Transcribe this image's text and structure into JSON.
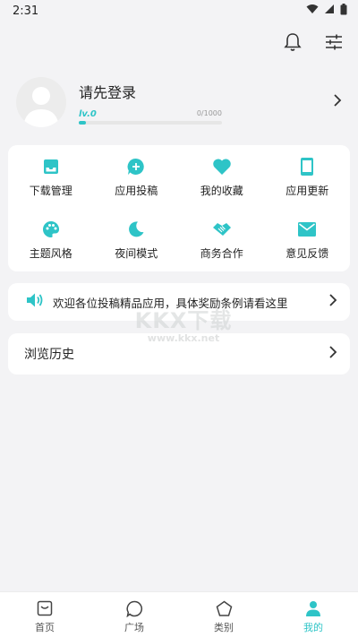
{
  "status_bar": {
    "time": "2:31"
  },
  "profile": {
    "login_prompt": "请先登录",
    "level": "lv.0",
    "exp": "0/1000",
    "progress_fraction": 0.05
  },
  "grid": [
    {
      "label": "下载管理",
      "icon": "inbox-icon"
    },
    {
      "label": "应用投稿",
      "icon": "chat-plus-icon"
    },
    {
      "label": "我的收藏",
      "icon": "heart-icon"
    },
    {
      "label": "应用更新",
      "icon": "phone-icon"
    },
    {
      "label": "主题风格",
      "icon": "palette-icon"
    },
    {
      "label": "夜间模式",
      "icon": "moon-icon"
    },
    {
      "label": "商务合作",
      "icon": "handshake-icon"
    },
    {
      "label": "意见反馈",
      "icon": "mail-icon"
    }
  ],
  "notice": {
    "text": "欢迎各位投稿精品应用，具体奖励条例请看这里"
  },
  "history": {
    "label": "浏览历史"
  },
  "watermark": {
    "big": "KKX下载",
    "small": "www.kkx.net"
  },
  "bottom_nav": [
    {
      "label": "首页",
      "icon": "home-icon",
      "active": false
    },
    {
      "label": "广场",
      "icon": "chat-bubble-icon",
      "active": false
    },
    {
      "label": "类别",
      "icon": "pentagon-icon",
      "active": false
    },
    {
      "label": "我的",
      "icon": "user-icon",
      "active": true
    }
  ],
  "colors": {
    "accent": "#2ec4c7",
    "background": "#f3f3f5",
    "card": "#ffffff"
  }
}
